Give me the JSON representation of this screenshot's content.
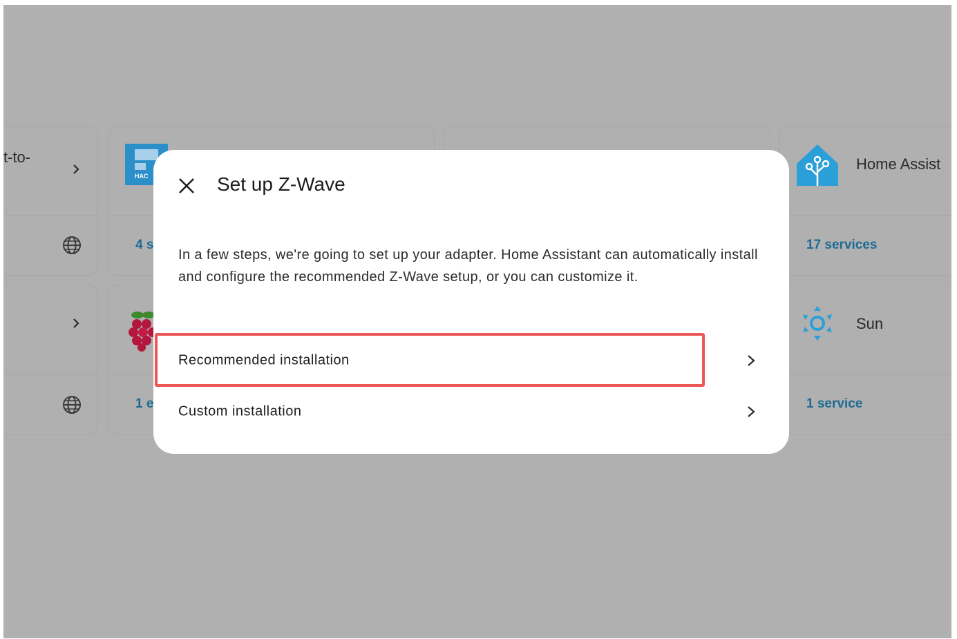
{
  "background_cards": {
    "card1": {
      "title_fragment": "t-to-"
    },
    "card2": {
      "icon_text": "HAC",
      "footer_fragment": "4 s"
    },
    "card4": {
      "title": "Home Assist",
      "footer": "17 services"
    },
    "card6": {
      "footer_fragment": "1 e"
    },
    "card7": {
      "title": "Sun",
      "footer": "1 service"
    }
  },
  "dialog": {
    "title": "Set up Z-Wave",
    "description": "In a few steps, we're going to set up your adapter. Home Assistant can automatically install and configure the recommended Z-Wave setup, or you can customize it.",
    "options": [
      {
        "label": "Recommended installation"
      },
      {
        "label": "Custom installation"
      }
    ],
    "highlight_color": "#ec5757"
  },
  "colors": {
    "overlay": "#b0b0b0",
    "link": "#1c6b94",
    "ha_blue": "#2b9fd8"
  }
}
